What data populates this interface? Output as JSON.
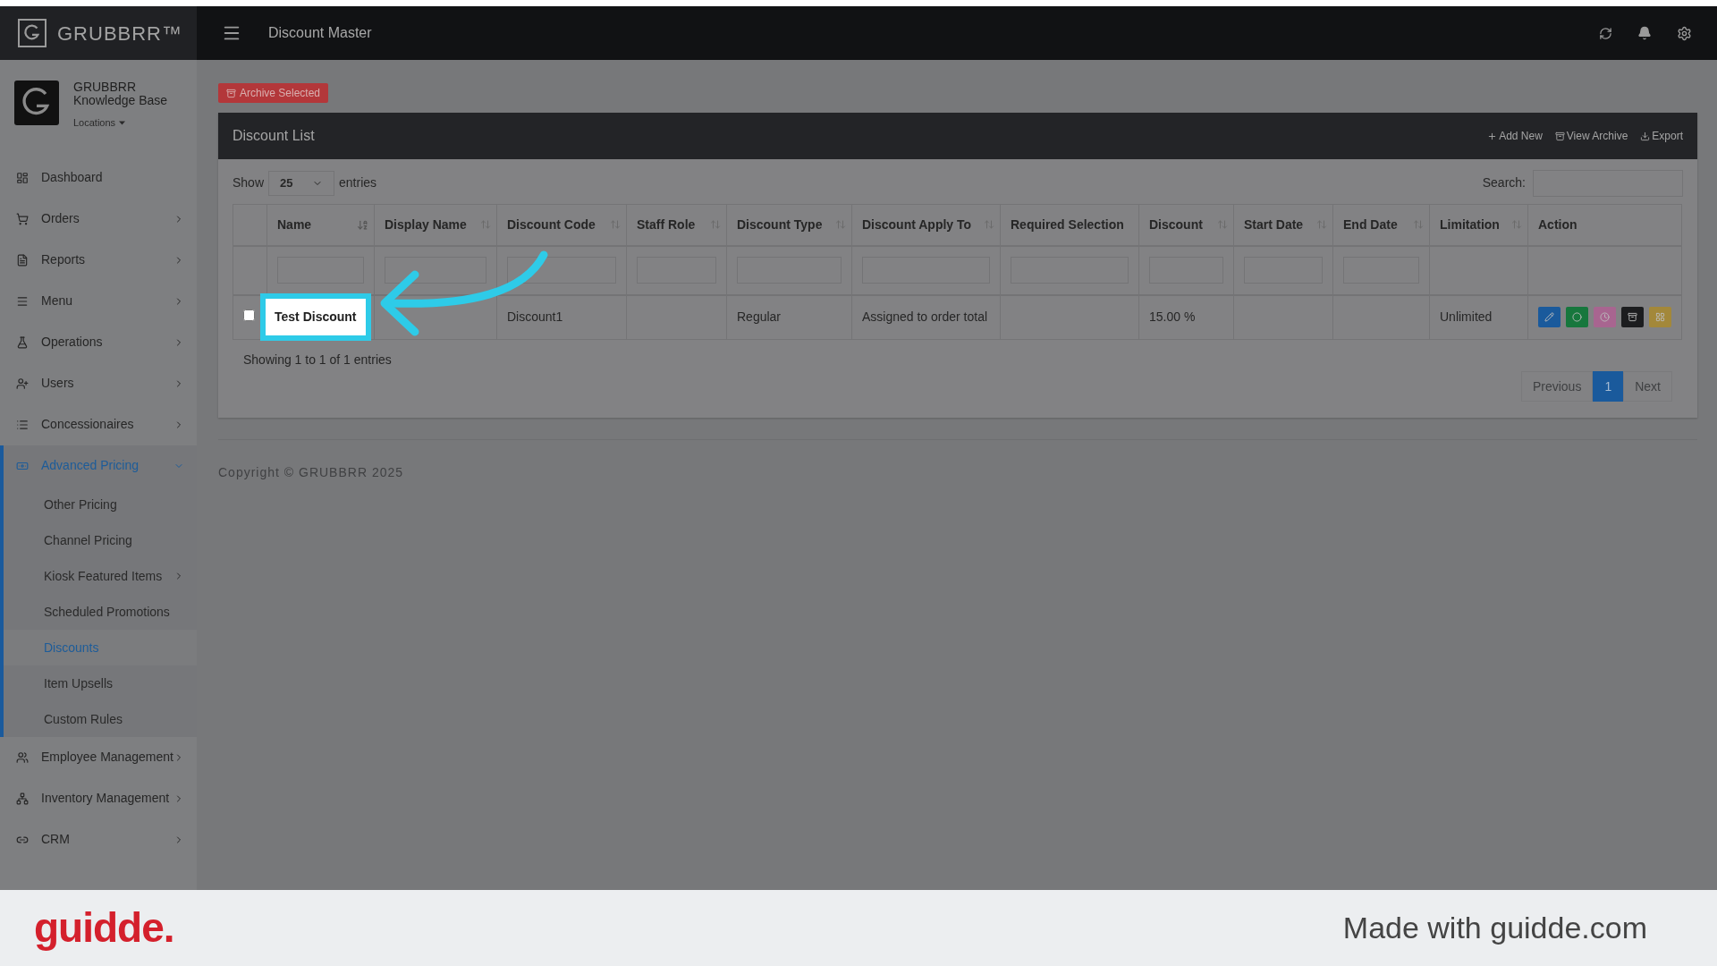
{
  "top_bar": {
    "brand": "GRUBBRR™",
    "title": "Discount Master"
  },
  "sidebar": {
    "org_name": "GRUBBRR Knowledge Base",
    "locations": "Locations",
    "items": [
      {
        "label": "Dashboard",
        "selected": false
      },
      {
        "label": "Orders",
        "selected": false,
        "expanded": false
      },
      {
        "label": "Reports",
        "selected": false,
        "expanded": false
      },
      {
        "label": "Menu",
        "selected": false,
        "expanded": false
      },
      {
        "label": "Operations",
        "selected": false,
        "expanded": false
      },
      {
        "label": "Users",
        "selected": false,
        "expanded": false
      },
      {
        "label": "Concessionaires",
        "selected": false,
        "expanded": false
      },
      {
        "label": "Advanced Pricing",
        "selected": true,
        "expanded": true,
        "children": [
          {
            "label": "Other Pricing",
            "selected": false
          },
          {
            "label": "Channel Pricing",
            "selected": false
          },
          {
            "label": "Kiosk Featured Items",
            "selected": false,
            "expanded": false
          },
          {
            "label": "Scheduled Promotions",
            "selected": false
          },
          {
            "label": "Discounts",
            "selected": true
          },
          {
            "label": "Item Upsells",
            "selected": false
          },
          {
            "label": "Custom Rules",
            "selected": false
          }
        ]
      },
      {
        "label": "Employee Management",
        "selected": false,
        "expanded": false
      },
      {
        "label": "Inventory Management",
        "selected": false,
        "expanded": false
      },
      {
        "label": "CRM",
        "selected": false,
        "expanded": false
      }
    ]
  },
  "archive_button": "Archive Selected",
  "card": {
    "title": "Discount List",
    "actions": [
      "Add New",
      "View Archive",
      "Export"
    ],
    "show_label": "Show",
    "page_size": "25",
    "entries_label": "entries",
    "search_label": "Search:",
    "table": {
      "columns": [
        {
          "filter": false
        },
        {
          "label": "Name",
          "sorted": true,
          "filter": true
        },
        {
          "label": "Display Name",
          "sorted": false,
          "filter": true
        },
        {
          "label": "Discount Code",
          "sorted": false,
          "filter": true
        },
        {
          "label": "Staff Role",
          "sorted": false,
          "filter": true
        },
        {
          "label": "Discount Type",
          "sorted": false,
          "filter": true
        },
        {
          "label": "Discount Apply To",
          "sorted": false,
          "filter": true
        },
        {
          "label": "Required Selection",
          "filter": true
        },
        {
          "label": "Discount",
          "sorted": false,
          "filter": true
        },
        {
          "label": "Start Date",
          "sorted": false,
          "filter": true
        },
        {
          "label": "End Date",
          "sorted": false,
          "filter": true
        },
        {
          "label": "Limitation",
          "sorted": false,
          "filter": false
        },
        {
          "label": "Action",
          "filter": false
        }
      ],
      "rows": [
        {
          "cells": [
            {
              "kind": "checkbox",
              "checked": false
            },
            {
              "text": "Test Discount",
              "highlighted": true
            },
            {
              "text": ""
            },
            {
              "text": "Discount1"
            },
            {
              "text": ""
            },
            {
              "text": "Regular"
            },
            {
              "text": "Assigned to order total"
            },
            {
              "text": ""
            },
            {
              "text": "15.00 %"
            },
            {
              "text": ""
            },
            {
              "text": ""
            },
            {
              "text": "Unlimited"
            },
            {
              "kind": "actions",
              "actions": [
                {
                  "kind": "edit",
                  "color": "#1a5a9c"
                },
                {
                  "kind": "toggle",
                  "color": "#17773d"
                },
                {
                  "kind": "clock",
                  "color": "#a86590"
                },
                {
                  "kind": "archive",
                  "color": "#1c1d1f"
                },
                {
                  "kind": "grid",
                  "color": "#a3883a"
                }
              ]
            }
          ]
        }
      ]
    },
    "info": "Showing 1 to 1 of 1 entries",
    "pagination": [
      {
        "label": "Previous",
        "selected": false,
        "disabled": true
      },
      {
        "label": "1",
        "selected": true,
        "disabled": false
      },
      {
        "label": "Next",
        "selected": false,
        "disabled": true
      }
    ]
  },
  "copyright": "Copyright © GRUBBRR 2025",
  "branding_bar": {
    "logo": "guidde.",
    "text": "Made with guidde.com"
  }
}
